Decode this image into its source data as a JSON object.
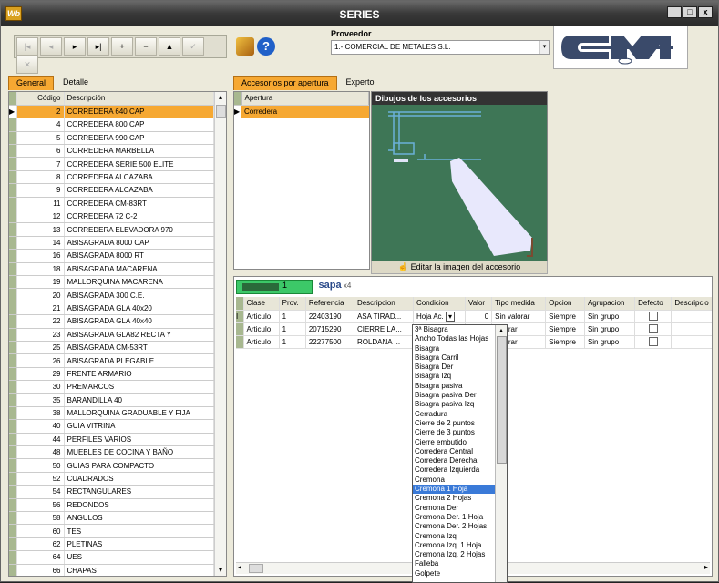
{
  "window": {
    "title": "SERIES",
    "app_icon_text": "Wb",
    "min": "_",
    "max": "□",
    "close": "x"
  },
  "toolbar": {
    "first": "|◂",
    "prev": "◂",
    "next": "▸",
    "last": "▸|",
    "add": "+",
    "remove": "−",
    "up": "▲",
    "confirm": "✓",
    "cancel": "✕"
  },
  "provider": {
    "label": "Proveedor",
    "value": "1.- COMERCIAL DE METALES S.L."
  },
  "left_tabs": [
    "General",
    "Detalle"
  ],
  "left_grid": {
    "headers": [
      "Código",
      "Descripción"
    ],
    "rows": [
      [
        "2",
        "CORREDERA 640 CAP"
      ],
      [
        "4",
        "CORREDERA 800 CAP"
      ],
      [
        "5",
        "CORREDERA 990 CAP"
      ],
      [
        "6",
        "CORREDERA MARBELLA"
      ],
      [
        "7",
        "CORREDERA SERIE 500 ELITE"
      ],
      [
        "8",
        "CORREDERA ALCAZABA"
      ],
      [
        "9",
        "CORREDERA ALCAZABA"
      ],
      [
        "11",
        "CORREDERA CM-83RT"
      ],
      [
        "12",
        "CORREDERA 72 C-2"
      ],
      [
        "13",
        "CORREDERA ELEVADORA 970"
      ],
      [
        "14",
        "ABISAGRADA 8000 CAP"
      ],
      [
        "16",
        "ABISAGRADA 8000 RT"
      ],
      [
        "18",
        "ABISAGRADA MACARENA"
      ],
      [
        "19",
        "MALLORQUINA MACARENA"
      ],
      [
        "20",
        "ABISAGRADA 300 C.E."
      ],
      [
        "21",
        "ABISAGRADA GLA 40x20"
      ],
      [
        "22",
        "ABISAGRADA GLA 40x40"
      ],
      [
        "23",
        "ABISAGRADA GLA82 RECTA Y"
      ],
      [
        "25",
        "ABISAGRADA CM-53RT"
      ],
      [
        "26",
        "ABISAGRADA PLEGABLE"
      ],
      [
        "29",
        "FRENTE ARMARIO"
      ],
      [
        "30",
        "PREMARCOS"
      ],
      [
        "35",
        "BARANDILLA 40"
      ],
      [
        "38",
        "MALLORQUINA GRADUABLE Y FIJA"
      ],
      [
        "40",
        "GUIA VITRINA"
      ],
      [
        "44",
        "PERFILES VARIOS"
      ],
      [
        "48",
        "MUEBLES DE COCINA Y BAÑO"
      ],
      [
        "50",
        "GUIAS PARA COMPACTO"
      ],
      [
        "52",
        "CUADRADOS"
      ],
      [
        "54",
        "RECTANGULARES"
      ],
      [
        "56",
        "REDONDOS"
      ],
      [
        "58",
        "ANGULOS"
      ],
      [
        "60",
        "TES"
      ],
      [
        "62",
        "PLETINAS"
      ],
      [
        "64",
        "UES"
      ],
      [
        "66",
        "CHAPAS"
      ]
    ]
  },
  "right_tabs": [
    "Accesorios por apertura",
    "Experto"
  ],
  "apertura": {
    "header": "Apertura",
    "rows": [
      "Corredera"
    ]
  },
  "drawing": {
    "title": "Dibujos de los accesorios",
    "edit_label": "Editar la imagen del accesorio"
  },
  "brands": {
    "cm_count": "1",
    "sapa": "sapa",
    "sapa_count": "4"
  },
  "bottom_grid": {
    "headers": [
      "Clase",
      "Prov.",
      "Referencia",
      "Descripcion",
      "Condicion",
      "Valor",
      "Tipo medida",
      "Opcion",
      "Agrupacion",
      "Defecto",
      "Descripcio"
    ],
    "rows": [
      [
        "Articulo",
        "1",
        "22403190",
        "ASA TIRAD...",
        "Hoja Ac.",
        "0",
        "Sin valorar",
        "Siempre",
        "Sin grupo"
      ],
      [
        "Articulo",
        "1",
        "20715290",
        "CIERRE LA...",
        "",
        "",
        "valorar",
        "Siempre",
        "Sin grupo"
      ],
      [
        "Articulo",
        "1",
        "22277500",
        "ROLDANA ...",
        "",
        "",
        "valorar",
        "Siempre",
        "Sin grupo"
      ]
    ]
  },
  "dropdown": {
    "options": [
      "3ª Bisagra",
      "Ancho Todas las Hojas",
      "Bisagra",
      "Bisagra Carril",
      "Bisagra Der",
      "Bisagra Izq",
      "Bisagra pasiva",
      "Bisagra pasiva Der",
      "Bisagra pasiva Izq",
      "Cerradura",
      "Cierre de 2 puntos",
      "Cierre de 3 puntos",
      "Cierre embutido",
      "Corredera Central",
      "Corredera Derecha",
      "Corredera Izquierda",
      "Cremona",
      "Cremona 1 Hoja",
      "Cremona 2 Hojas",
      "Cremona Der",
      "Cremona Der. 1 Hoja",
      "Cremona Der. 2 Hojas",
      "Cremona Izq",
      "Cremona Izq. 1 Hoja",
      "Cremona Izq. 2 Hojas",
      "Falleba",
      "Golpete"
    ],
    "highlighted": "Cremona 1 Hoja"
  }
}
